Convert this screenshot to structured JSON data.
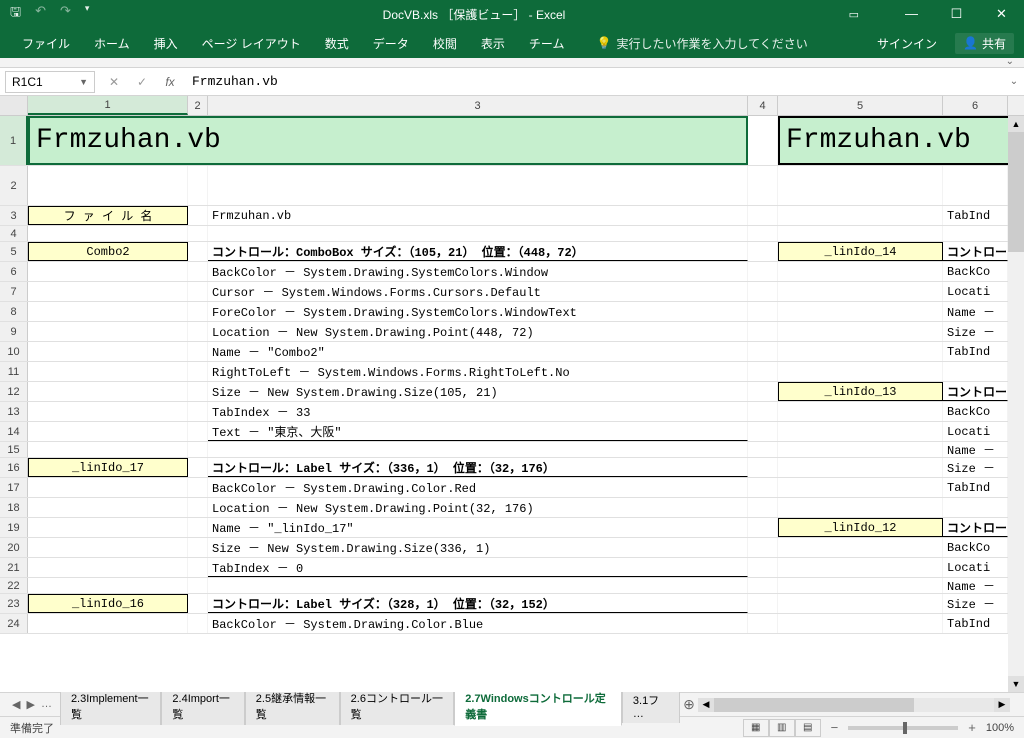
{
  "titlebar": {
    "title": "DocVB.xls ［保護ビュー］ - Excel"
  },
  "ribbon": {
    "tabs": [
      "ファイル",
      "ホーム",
      "挿入",
      "ページ レイアウト",
      "数式",
      "データ",
      "校閲",
      "表示",
      "チーム"
    ],
    "tellme": "実行したい作業を入力してください",
    "signin": "サインイン",
    "share": "共有"
  },
  "formula": {
    "namebox": "R1C1",
    "value": "Frmzuhan.vb"
  },
  "cols": [
    "1",
    "2",
    "3",
    "4",
    "5",
    "6"
  ],
  "title_left": "Frmzuhan.vb",
  "title_right": "Frmzuhan.vb",
  "label_filename": "フ ァ イ ル 名",
  "val_filename": "Frmzuhan.vb",
  "r3_right": "TabInd",
  "boxes": {
    "combo2": "Combo2",
    "lin17": "_linIdo_17",
    "lin16": "_linIdo_16",
    "lin14": "_linIdo_14",
    "lin13": "_linIdo_13",
    "lin12": "_linIdo_12"
  },
  "r5_head": "コントロール：ComboBox  サイズ：（105，21）  位置：（448，72）",
  "r5_right": "コントロー",
  "r6": "BackColor － System.Drawing.SystemColors.Window",
  "r6_right": "BackCo",
  "r7": "Cursor － System.Windows.Forms.Cursors.Default",
  "r7_right": "Locati",
  "r8": "ForeColor － System.Drawing.SystemColors.WindowText",
  "r8_right": "Name －",
  "r9": "Location － New System.Drawing.Point(448, 72)",
  "r9_right": "Size －",
  "r10": "Name － \"Combo2\"",
  "r10_right": "TabInd",
  "r11": "RightToLeft － System.Windows.Forms.RightToLeft.No",
  "r12": "Size － New System.Drawing.Size(105, 21)",
  "r12_right": "コントロー",
  "r13": "TabIndex － 33",
  "r13_right": "BackCo",
  "r14": "Text － \"東京、大阪\"",
  "r14_right": "Locati",
  "r15_right": "Name －",
  "r16_head": "コントロール：Label  サイズ：（336，1）  位置：（32，176）",
  "r16_right": "Size －",
  "r17": "BackColor － System.Drawing.Color.Red",
  "r17_right": "TabInd",
  "r18": "Location － New System.Drawing.Point(32, 176)",
  "r19": "Name － \"_linIdo_17\"",
  "r19_right": "コントロー",
  "r20": "Size － New System.Drawing.Size(336, 1)",
  "r20_right": "BackCo",
  "r21": "TabIndex － 0",
  "r21_right": "Locati",
  "r22_right": "Name －",
  "r23_head": "コントロール：Label  サイズ：（328，1）  位置：（32，152）",
  "r23_right": "Size －",
  "r24": "BackColor － System.Drawing.Color.Blue",
  "r24_right": "TabInd",
  "sheets": {
    "tabs": [
      "2.3Implement一覧",
      "2.4Import一覧",
      "2.5継承情報一覧",
      "2.6コントロール一覧",
      "2.7Windowsコントロール定義書",
      "3.1フ …"
    ],
    "active": 4,
    "ellipsis": "…"
  },
  "status": {
    "ready": "準備完了",
    "zoom": "100%"
  }
}
